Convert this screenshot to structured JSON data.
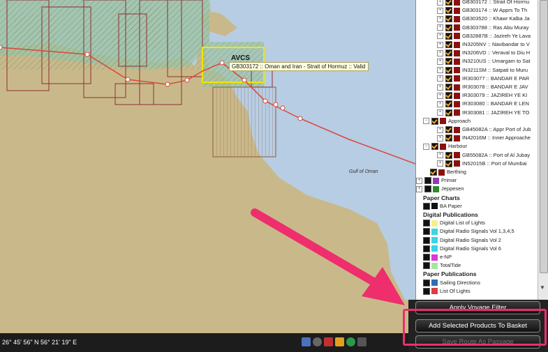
{
  "map": {
    "selected_label": "AVCS",
    "tooltip": "GB303172 :: Oman and Iran - Strait of Hormuz :: Valid",
    "sea_label": "Gulf of Oman",
    "colors": {
      "land": "#c9b98a",
      "sea": "#b7cde3",
      "coverage": "#9fc3a3",
      "route": "#d9473b",
      "selection": "#f2e600",
      "annotation_arrow": "#ee2e6d"
    }
  },
  "status": {
    "coordinates": "26° 45' 56\" N 56° 21' 19\" E",
    "icons": [
      "layers-icon",
      "globe-icon",
      "shield-icon",
      "warning-icon",
      "world-icon",
      "cart-icon"
    ]
  },
  "tree": {
    "cells": [
      {
        "label": "GB303172 :: Strait Of Hormu"
      },
      {
        "label": "GB303174 :: W Apprs To Th"
      },
      {
        "label": "GB303520 :: Khawr Kalba Ja"
      },
      {
        "label": "GB303788 :: Ras Abu Muray"
      },
      {
        "label": "GB32887B :: Jazireh Ye Lava"
      },
      {
        "label": "IN3205NV :: Navibandar to V"
      },
      {
        "label": "IN3206VD :: Veraval to Diu H"
      },
      {
        "label": "IN3210US :: Umargam to Sat"
      },
      {
        "label": "IN3211SM :: Satpati to Muru"
      },
      {
        "label": "IR303077 :: BANDAR E PAR"
      },
      {
        "label": "IR303078 :: BANDAR E JAV"
      },
      {
        "label": "IR303079 :: JAZIREH YE KI"
      },
      {
        "label": "IR303080 :: BANDAR E LEN"
      },
      {
        "label": "IR303081 :: JAZIREH YE TO"
      }
    ],
    "approach_label": "Approach",
    "approach_cells": [
      {
        "label": "GB45082A :: Appr Port of Jub"
      },
      {
        "label": "IN42016M :: Inner Approache"
      }
    ],
    "harbour_label": "Harbour",
    "harbour_cells": [
      {
        "label": "GB55082A :: Port of Al Jubay"
      },
      {
        "label": "IN52015B :: Port of Mumbai"
      }
    ],
    "berthing_label": "Berthing",
    "providers": [
      {
        "label": "Primar",
        "color": "#8e3cb0"
      },
      {
        "label": "Jeppesen",
        "color": "#2f8a2f"
      }
    ],
    "paper_charts_header": "Paper Charts",
    "paper_charts": [
      {
        "label": "BA Paper",
        "color": "#111111"
      }
    ],
    "digital_pubs_header": "Digital Publications",
    "digital_pubs": [
      {
        "label": "Digital List of Lights",
        "color": "#f7f08a"
      },
      {
        "label": "Digital Radio Signals Vol 1,3,4,5",
        "color": "#39d5e6"
      },
      {
        "label": "Digital Radio Signals Vol 2",
        "color": "#39d5e6"
      },
      {
        "label": "Digital Radio Signals Vol 6",
        "color": "#39d5e6"
      },
      {
        "label": "e-NP",
        "color": "#d83ad8"
      },
      {
        "label": "TotalTide",
        "color": "#a8e6a0"
      }
    ],
    "paper_pubs_header": "Paper Publications",
    "paper_pubs": [
      {
        "label": "Sailing Directions",
        "color": "#2f6db8"
      },
      {
        "label": "List Of Lights",
        "color": "#d84040"
      }
    ]
  },
  "buttons": {
    "apply_voyage_filter": "Apply Voyage Filter",
    "add_selected": "Add Selected Products To Basket",
    "save_route": "Save Route As Passage"
  }
}
